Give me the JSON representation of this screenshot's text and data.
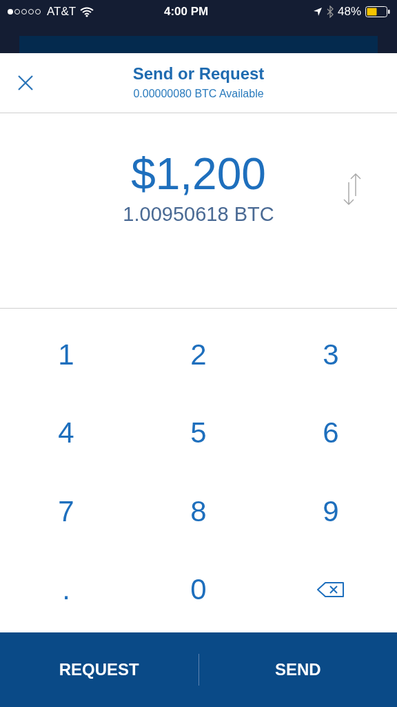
{
  "status_bar": {
    "carrier": "AT&T",
    "time": "4:00 PM",
    "battery_percent": "48%"
  },
  "header": {
    "title": "Send or Request",
    "subtitle": "0.00000080 BTC Available"
  },
  "amount": {
    "fiat": "$1,200",
    "crypto": "1.00950618 BTC"
  },
  "keypad": [
    {
      "kind": "key",
      "label": "1"
    },
    {
      "kind": "key",
      "label": "2"
    },
    {
      "kind": "key",
      "label": "3"
    },
    {
      "kind": "key",
      "label": "4"
    },
    {
      "kind": "key",
      "label": "5"
    },
    {
      "kind": "key",
      "label": "6"
    },
    {
      "kind": "key",
      "label": "7"
    },
    {
      "kind": "key",
      "label": "8"
    },
    {
      "kind": "key",
      "label": "9"
    },
    {
      "kind": "key",
      "label": "."
    },
    {
      "kind": "key",
      "label": "0"
    },
    {
      "kind": "backspace"
    }
  ],
  "actions": [
    "REQUEST",
    "SEND"
  ]
}
